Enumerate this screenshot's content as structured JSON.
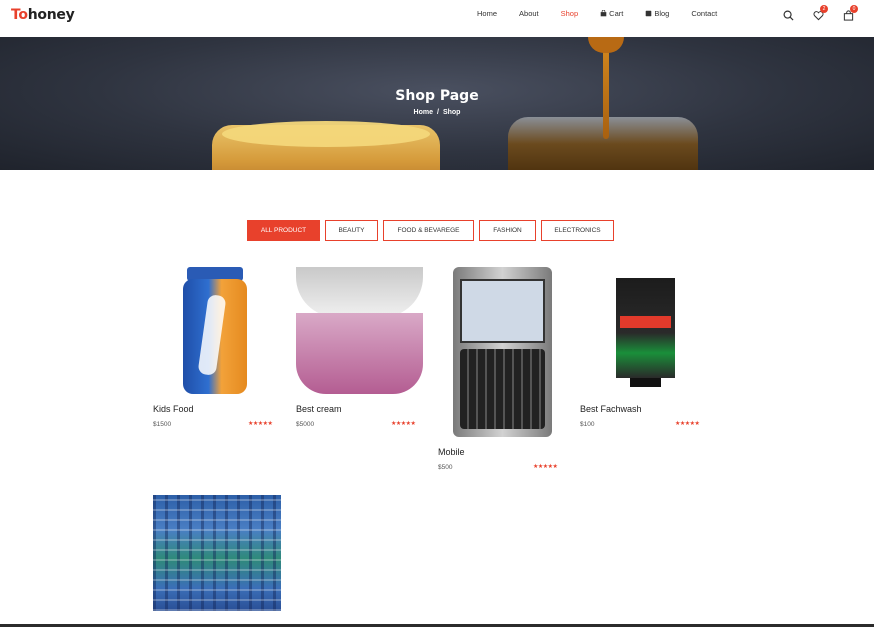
{
  "brand": {
    "part1": "To",
    "part2": "honey"
  },
  "nav": {
    "items": [
      {
        "label": "Home"
      },
      {
        "label": "About"
      },
      {
        "label": "Shop"
      },
      {
        "label": "Cart"
      },
      {
        "label": "Blog"
      },
      {
        "label": "Contact"
      }
    ],
    "active": "Shop"
  },
  "header_icons": {
    "search": "search-icon",
    "wishlist": "heart-icon",
    "cart": "cart-icon",
    "wishlist_count": "2",
    "cart_count": "0"
  },
  "hero": {
    "title": "Shop Page",
    "crumb_home": "Home",
    "crumb_sep": "/",
    "crumb_current": "Shop"
  },
  "filters": [
    "ALL PRODUCT",
    "BEAUTY",
    "FOOD & BEVAREGE",
    "FASHION",
    "ELECTRONICS"
  ],
  "products": [
    {
      "name": "Kids Food",
      "price": "$1500",
      "rating": "★★★★★"
    },
    {
      "name": "Best cream",
      "price": "$5000",
      "rating": "★★★★★"
    },
    {
      "name": "Mobile",
      "price": "$500",
      "rating": "★★★★★"
    },
    {
      "name": "Best Fachwash",
      "price": "$100",
      "rating": "★★★★★"
    }
  ],
  "colors": {
    "accent": "#e8412c",
    "text": "#222222"
  }
}
